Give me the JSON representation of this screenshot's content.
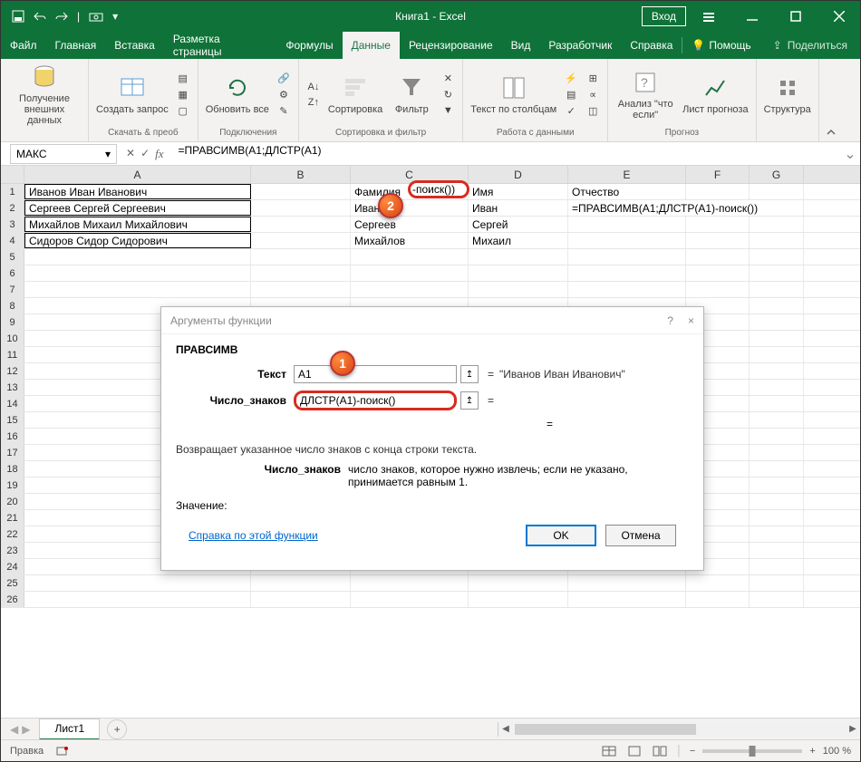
{
  "app": {
    "title": "Книга1  -  Excel"
  },
  "titlebar": {
    "login": "Вход"
  },
  "menu": {
    "file": "Файл",
    "home": "Главная",
    "insert": "Вставка",
    "layout": "Разметка страницы",
    "formulas": "Формулы",
    "data": "Данные",
    "review": "Рецензирование",
    "view": "Вид",
    "developer": "Разработчик",
    "help": "Справка",
    "search_hint": "Помощь",
    "share": "Поделиться"
  },
  "ribbon": {
    "g1": {
      "btn": "Получение внешних данных"
    },
    "g2": {
      "btn": "Создать запрос",
      "label": "Скачать & преоб"
    },
    "g3": {
      "btn": "Обновить все",
      "label": "Подключения"
    },
    "g4": {
      "a": "A↓",
      "z": "Z↑",
      "sort": "Сортировка",
      "filter": "Фильтр",
      "label": "Сортировка и фильтр"
    },
    "g5": {
      "btn": "Текст по столбцам",
      "label": "Работа с данными"
    },
    "g6": {
      "btn1": "Анализ \"что если\"",
      "btn2": "Лист прогноза",
      "label": "Прогноз"
    },
    "g7": {
      "btn": "Структура"
    }
  },
  "formula": {
    "namebox": "МАКС",
    "text_before": "=ПРАВСИМВ(A1;ДЛСТР(A1)",
    "text_callout": "-поиск()",
    "text_after": ")"
  },
  "cols": {
    "A": "A",
    "B": "B",
    "C": "C",
    "D": "D",
    "E": "E",
    "F": "F",
    "G": "G"
  },
  "cells": {
    "A1": "Иванов Иван Иванович",
    "A2": "Сергеев Сергей Сергеевич",
    "A3": "Михайлов Михаил Михайлович",
    "A4": "Сидоров Сидор Сидорович",
    "C1": "Фамилия",
    "C2": "Иванов",
    "C3": "Сергеев",
    "C4": "Михайлов",
    "D1": "Имя",
    "D2": "Иван",
    "D3": "Сергей",
    "D4": "Михаил",
    "E1": "Отчество",
    "E2": "=ПРАВСИМВ(A1;ДЛСТР(A1)-поиск())"
  },
  "sheet": {
    "name": "Лист1"
  },
  "status": {
    "mode": "Правка",
    "zoom": "100 %"
  },
  "dialog": {
    "title": "Аргументы функции",
    "func": "ПРАВСИМВ",
    "arg1_label": "Текст",
    "arg1_value": "A1",
    "arg1_result": "\"Иванов Иван Иванович\"",
    "arg2_label": "Число_знаков",
    "arg2_value": "ДЛСТР(A1)-поиск()",
    "eq": "=",
    "desc": "Возвращает указанное число знаков с конца строки текста.",
    "param_label": "Число_знаков",
    "param_text": "число знаков, которое нужно извлечь; если не указано, принимается равным 1.",
    "result_label": "Значение:",
    "help": "Справка по этой функции",
    "ok": "OK",
    "cancel": "Отмена"
  },
  "tooltips": {
    "close": "?",
    "x": "×"
  }
}
